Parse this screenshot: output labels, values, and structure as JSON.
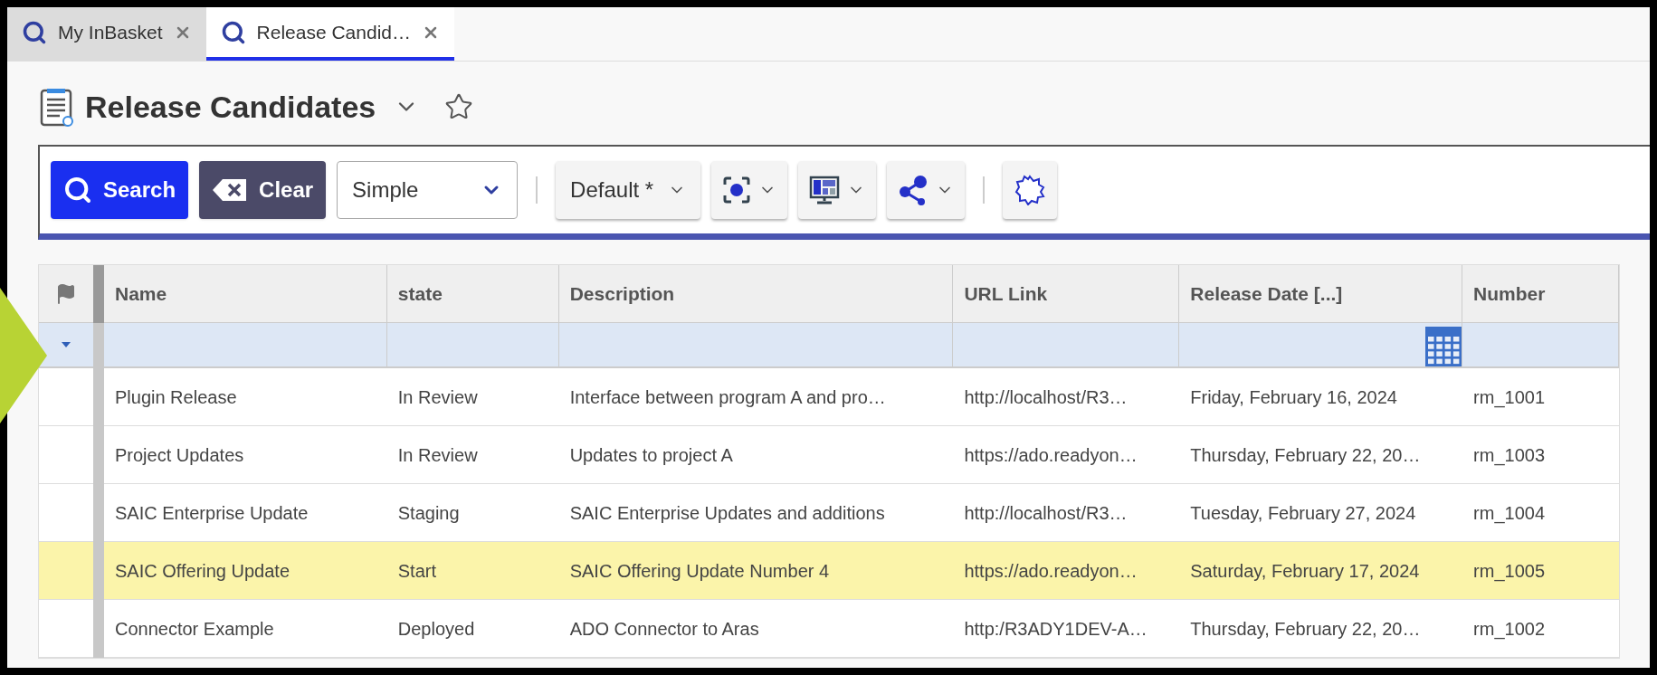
{
  "tabs": [
    {
      "label": "My InBasket",
      "selected": false
    },
    {
      "label": "Release Candid…",
      "selected": true
    }
  ],
  "title": "Release Candidates",
  "toolbar": {
    "search_button": "Search",
    "clear_button": "Clear",
    "mode_select": {
      "value": "Simple"
    },
    "layout_select": {
      "value": "Default *"
    }
  },
  "table": {
    "columns": [
      "Name",
      "state",
      "Description",
      "URL Link",
      "Release Date [...]",
      "Number"
    ],
    "rows": [
      {
        "cells": [
          "Plugin Release",
          "In Review",
          "Interface between program A and pro…",
          "http://localhost/R3…",
          "Friday, February 16, 2024",
          "rm_1001"
        ],
        "selected": false
      },
      {
        "cells": [
          "Project Updates",
          "In Review",
          "Updates to project A",
          "https://ado.readyon…",
          "Thursday, February 22, 20…",
          "rm_1003"
        ],
        "selected": false
      },
      {
        "cells": [
          "SAIC Enterprise Update",
          "Staging",
          "SAIC Enterprise Updates and additions",
          "http://localhost/R3…",
          "Tuesday, February 27, 2024",
          "rm_1004"
        ],
        "selected": false
      },
      {
        "cells": [
          "SAIC Offering Update",
          "Start",
          "SAIC Offering Update Number 4",
          "https://ado.readyon…",
          "Saturday, February 17, 2024",
          "rm_1005"
        ],
        "selected": true
      },
      {
        "cells": [
          "Connector Example",
          "Deployed",
          "ADO Connector to Aras",
          "http:/R3ADY1DEV-A…",
          "Thursday, February 22, 20…",
          "rm_1002"
        ],
        "selected": false
      }
    ]
  }
}
